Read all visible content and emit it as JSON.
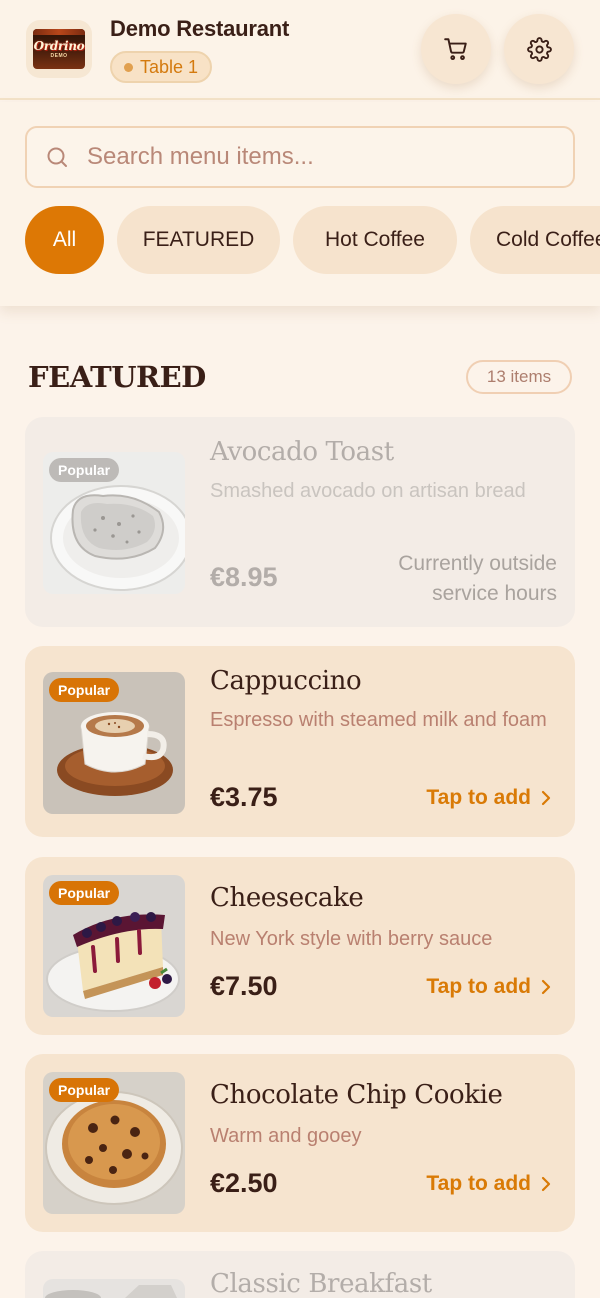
{
  "header": {
    "logo_text": "Ordrino",
    "logo_subtext": "DEMO",
    "restaurant_name": "Demo Restaurant",
    "table_label": "Table 1",
    "cart_icon": "cart-icon",
    "settings_icon": "gear-icon"
  },
  "search": {
    "placeholder": "Search menu items...",
    "icon": "search-icon"
  },
  "categories": [
    {
      "label": "All",
      "active": true
    },
    {
      "label": "FEATURED",
      "active": false
    },
    {
      "label": "Hot Coffee",
      "active": false
    },
    {
      "label": "Cold Coffee",
      "active": false
    }
  ],
  "section": {
    "title": "FEATURED",
    "count_label": "13 items"
  },
  "items": [
    {
      "badge": "Popular",
      "name": "Avocado Toast",
      "description": "Smashed avocado on artisan bread",
      "price": "€8.95",
      "status": "Currently outside service hours",
      "available": false
    },
    {
      "badge": "Popular",
      "name": "Cappuccino",
      "description": "Espresso with steamed milk and foam",
      "price": "€3.75",
      "action": "Tap to add",
      "available": true
    },
    {
      "badge": "Popular",
      "name": "Cheesecake",
      "description": "New York style with berry sauce",
      "price": "€7.50",
      "action": "Tap to add",
      "available": true
    },
    {
      "badge": "Popular",
      "name": "Chocolate Chip Cookie",
      "description": "Warm and gooey",
      "price": "€2.50",
      "action": "Tap to add",
      "available": true
    },
    {
      "name": "Classic Breakfast",
      "available": true
    }
  ],
  "colors": {
    "accent": "#dd7805",
    "background": "#fcf3ea",
    "card": "#f6e4cf",
    "text": "#3a1f17",
    "muted": "#b98070"
  }
}
